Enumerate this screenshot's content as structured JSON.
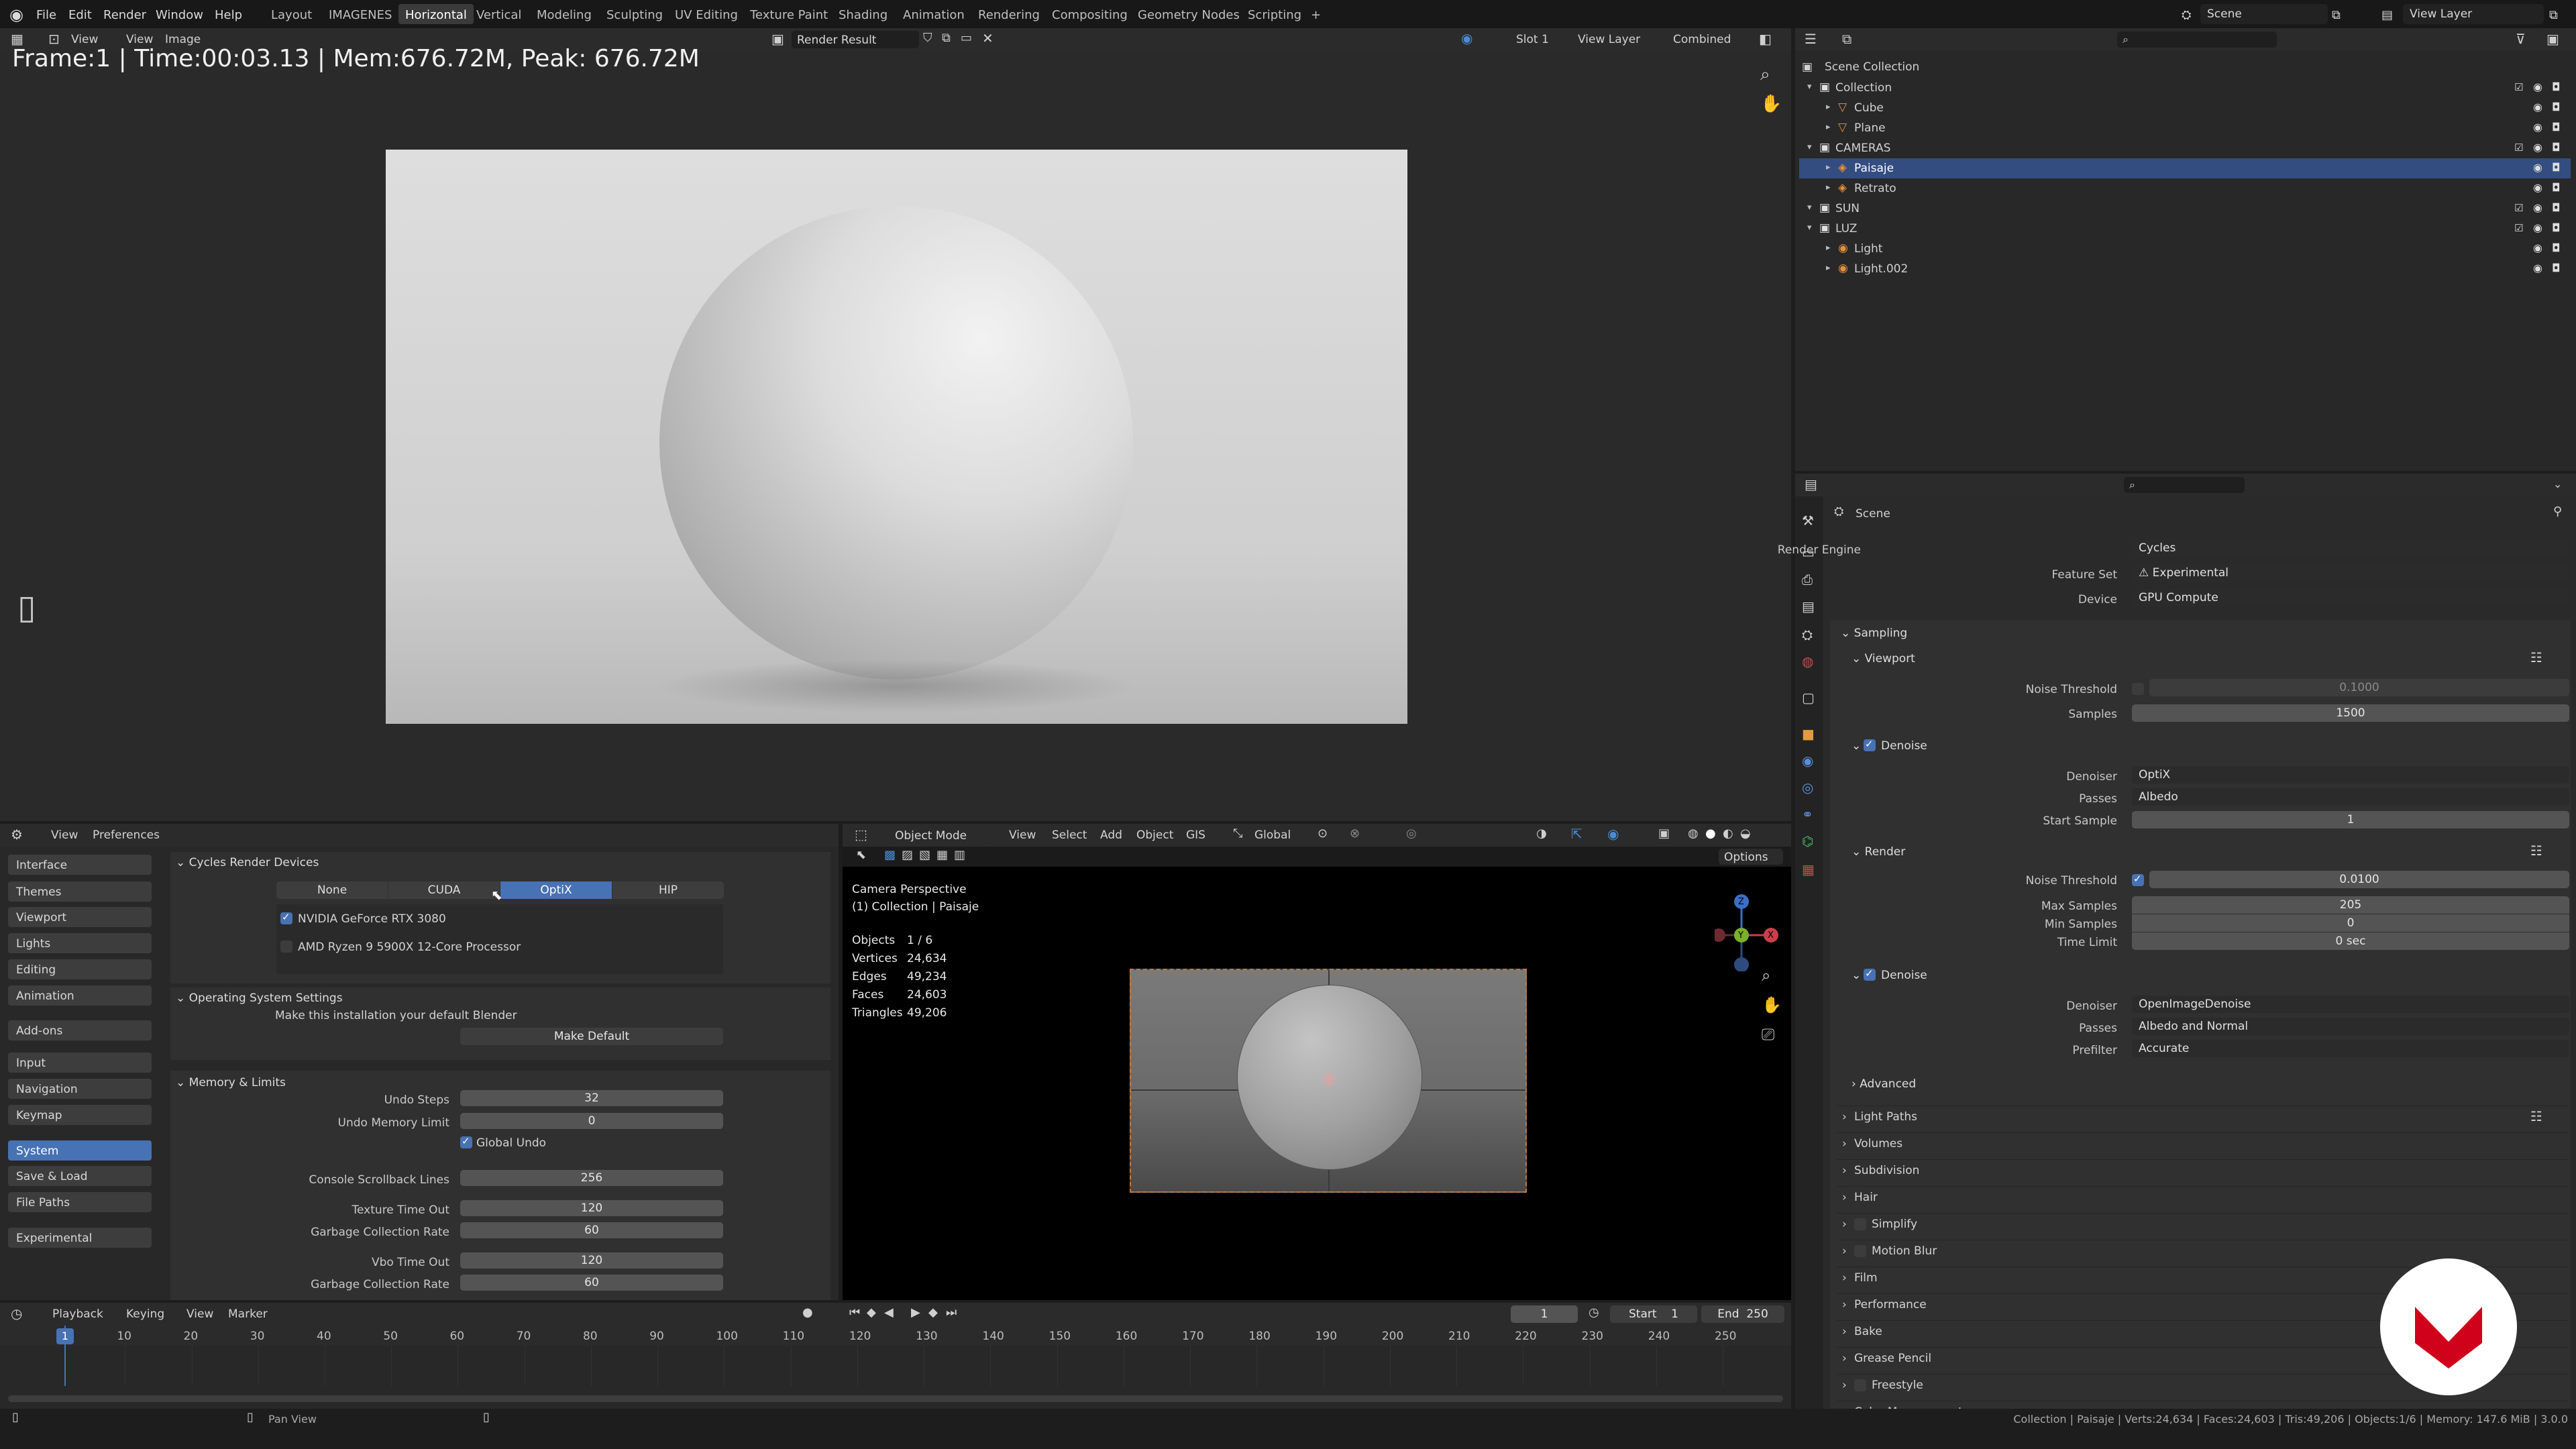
{
  "topbar": {
    "menus": [
      "File",
      "Edit",
      "Render",
      "Window",
      "Help"
    ],
    "workspaces": [
      "Layout",
      "IMAGENES",
      "Horizontal",
      "Vertical",
      "Modeling",
      "Sculpting",
      "UV Editing",
      "Texture Paint",
      "Shading",
      "Animation",
      "Rendering",
      "Compositing",
      "Geometry Nodes",
      "Scripting",
      "+"
    ],
    "active_workspace": "Horizontal",
    "scene": "Scene",
    "view_layer": "View Layer"
  },
  "image_editor": {
    "menus": [
      "View",
      "View",
      "Image"
    ],
    "image_name": "Render Result",
    "slot": "Slot 1",
    "layer": "View Layer",
    "pass": "Combined",
    "stats": "Frame:1 | Time:00:03.13 | Mem:676.72M, Peak: 676.72M"
  },
  "preferences": {
    "menus": [
      "View",
      "Preferences"
    ],
    "nav": [
      "Interface",
      "Themes",
      "Viewport",
      "Lights",
      "Editing",
      "Animation",
      "Add-ons",
      "Input",
      "Navigation",
      "Keymap",
      "System",
      "Save & Load",
      "File Paths",
      "Experimental"
    ],
    "active_nav": "System",
    "cycles_title": "Cycles Render Devices",
    "device_tabs": [
      "None",
      "CUDA",
      "OptiX",
      "HIP"
    ],
    "active_device_tab": "OptiX",
    "devices": [
      {
        "name": "NVIDIA GeForce RTX 3080",
        "checked": true
      },
      {
        "name": "AMD Ryzen 9 5900X 12-Core Processor",
        "checked": false
      }
    ],
    "os_title": "Operating System Settings",
    "os_text": "Make this installation your default Blender",
    "make_default": "Make Default",
    "mem_title": "Memory & Limits",
    "undo_steps_label": "Undo Steps",
    "undo_steps": "32",
    "undo_mem_label": "Undo Memory Limit",
    "undo_mem": "0",
    "global_undo": "Global Undo",
    "console_label": "Console Scrollback Lines",
    "console": "256",
    "tex_timeout_label": "Texture Time Out",
    "tex_timeout": "120",
    "gc_label": "Garbage Collection Rate",
    "gc": "60",
    "vbo_label": "Vbo Time Out",
    "vbo": "120",
    "gc2_label": "Garbage Collection Rate",
    "gc2": "60"
  },
  "viewport": {
    "mode": "Object Mode",
    "menus": [
      "View",
      "Select",
      "Add",
      "Object",
      "GIS"
    ],
    "orientation": "Global",
    "options": "Options",
    "camera_label": "Camera Perspective",
    "collection_label": "(1) Collection | Paisaje",
    "stats": [
      {
        "k": "Objects",
        "v": "1 / 6"
      },
      {
        "k": "Vertices",
        "v": "24,634"
      },
      {
        "k": "Edges",
        "v": "49,234"
      },
      {
        "k": "Faces",
        "v": "24,603"
      },
      {
        "k": "Triangles",
        "v": "49,206"
      }
    ],
    "gizmo": {
      "x": "X",
      "y": "Y",
      "z": "Z"
    }
  },
  "outliner": {
    "root": "Scene Collection",
    "rows": [
      {
        "label": "Collection",
        "indent": 1,
        "type": "collection"
      },
      {
        "label": "Cube",
        "indent": 2,
        "type": "mesh"
      },
      {
        "label": "Plane",
        "indent": 2,
        "type": "mesh"
      },
      {
        "label": "CAMERAS",
        "indent": 1,
        "type": "collection"
      },
      {
        "label": "Paisaje",
        "indent": 2,
        "type": "camera",
        "active": true
      },
      {
        "label": "Retrato",
        "indent": 2,
        "type": "camera"
      },
      {
        "label": "SUN",
        "indent": 1,
        "type": "collection"
      },
      {
        "label": "LUZ",
        "indent": 1,
        "type": "collection"
      },
      {
        "label": "Light",
        "indent": 2,
        "type": "light"
      },
      {
        "label": "Light.002",
        "indent": 2,
        "type": "light"
      }
    ]
  },
  "properties": {
    "context": "Scene",
    "render_engine_label": "Render Engine",
    "render_engine": "Cycles",
    "feature_set_label": "Feature Set",
    "feature_set": "Experimental",
    "device_label": "Device",
    "device": "GPU Compute",
    "sampling": "Sampling",
    "viewport": "Viewport",
    "noise_threshold_label": "Noise Threshold",
    "vp_noise_threshold": "0.1000",
    "samples_label": "Samples",
    "vp_samples": "1500",
    "denoise": "Denoise",
    "denoiser_label": "Denoiser",
    "vp_denoiser": "OptiX",
    "passes_label": "Passes",
    "vp_passes": "Albedo",
    "start_sample_label": "Start Sample",
    "vp_start_sample": "1",
    "render": "Render",
    "r_noise_threshold": "0.0100",
    "max_samples_label": "Max Samples",
    "r_max_samples": "205",
    "min_samples_label": "Min Samples",
    "r_min_samples": "0",
    "time_limit_label": "Time Limit",
    "r_time_limit": "0 sec",
    "r_denoiser": "OpenImageDenoise",
    "r_passes": "Albedo and Normal",
    "prefilter_label": "Prefilter",
    "r_prefilter": "Accurate",
    "sections": [
      "Advanced",
      "Light Paths",
      "Volumes",
      "Subdivision",
      "Hair",
      "Simplify",
      "Motion Blur",
      "Film",
      "Performance",
      "Bake",
      "Grease Pencil",
      "Freestyle",
      "Color Management"
    ]
  },
  "timeline": {
    "menus": [
      "Playback",
      "Keying",
      "View",
      "Marker"
    ],
    "current_frame": "1",
    "start_label": "Start",
    "start": "1",
    "end_label": "End",
    "end": "250",
    "ticks": [
      "1",
      "10",
      "20",
      "30",
      "40",
      "50",
      "60",
      "70",
      "80",
      "90",
      "100",
      "110",
      "120",
      "130",
      "140",
      "150",
      "160",
      "170",
      "180",
      "190",
      "200",
      "210",
      "220",
      "230",
      "240",
      "250"
    ]
  },
  "statusbar": {
    "pan_view": "Pan View",
    "info": "Collection | Paisaje | Verts:24,634 | Faces:24,603 | Tris:49,206 | Objects:1/6 | Memory: 147.6 MiB | 3.0.0"
  },
  "colors": {
    "accent": "#4772b3",
    "bg": "#1d1d1d",
    "panel": "#303030",
    "header": "#2a2a2a",
    "brand": "#d0021b"
  }
}
